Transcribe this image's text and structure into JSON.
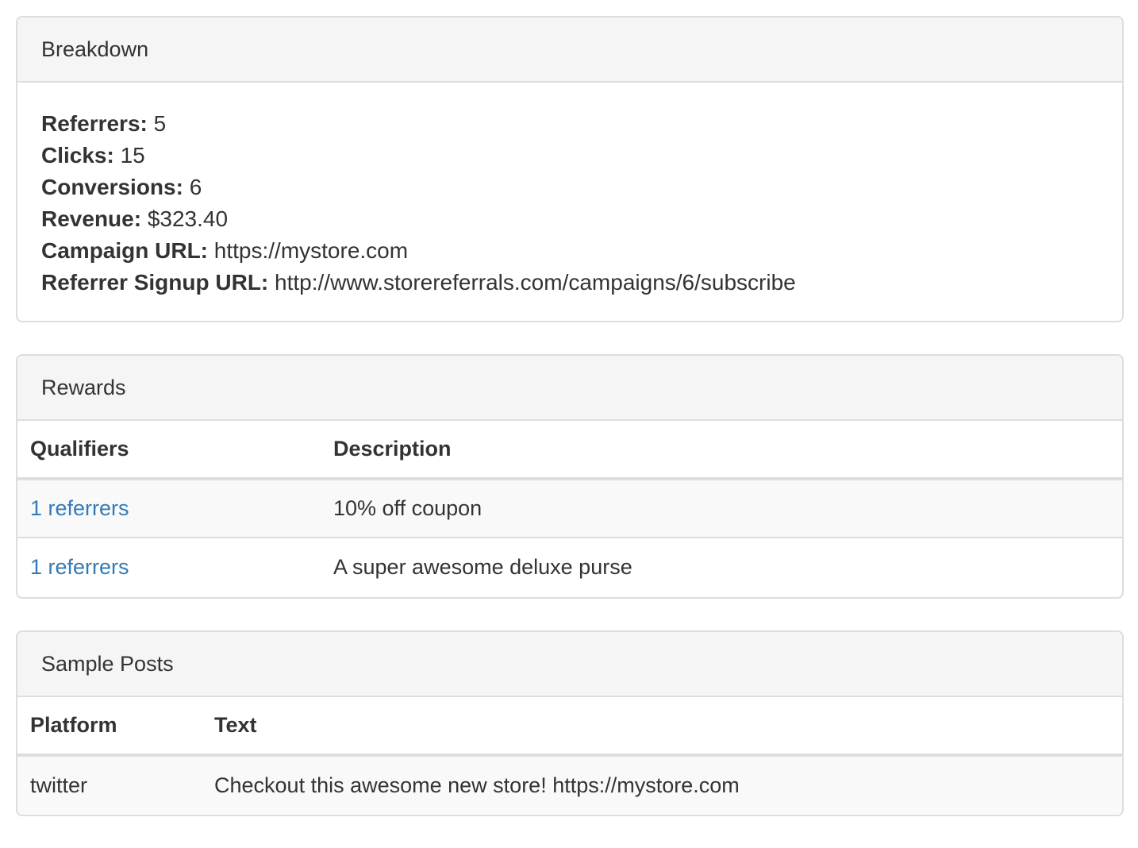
{
  "breakdown": {
    "title": "Breakdown",
    "stats": [
      {
        "label": "Referrers:",
        "value": "5"
      },
      {
        "label": "Clicks:",
        "value": "15"
      },
      {
        "label": "Conversions:",
        "value": "6"
      },
      {
        "label": "Revenue:",
        "value": "$323.40"
      },
      {
        "label": "Campaign URL:",
        "value": "https://mystore.com"
      },
      {
        "label": "Referrer Signup URL:",
        "value": "http://www.storereferrals.com/campaigns/6/subscribe"
      }
    ]
  },
  "rewards": {
    "title": "Rewards",
    "columns": [
      "Qualifiers",
      "Description"
    ],
    "rows": [
      {
        "qualifier": "1 referrers",
        "description": "10% off coupon"
      },
      {
        "qualifier": "1 referrers",
        "description": "A super awesome deluxe purse"
      }
    ]
  },
  "sample_posts": {
    "title": "Sample Posts",
    "columns": [
      "Platform",
      "Text"
    ],
    "rows": [
      {
        "platform": "twitter",
        "text": "Checkout this awesome new store! https://mystore.com"
      }
    ]
  },
  "colors": {
    "link": "#337ab7",
    "panel_heading_bg": "#f5f5f5",
    "border": "#dddddd",
    "text": "#333333"
  }
}
